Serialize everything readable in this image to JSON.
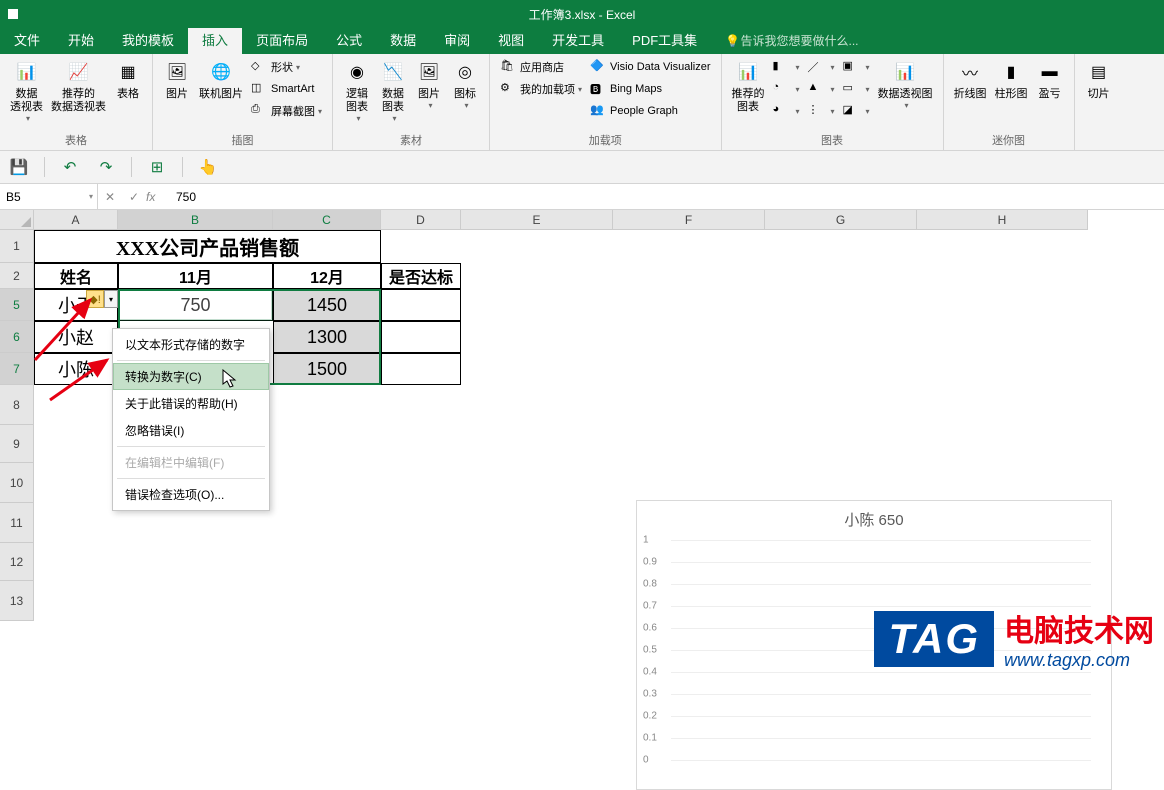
{
  "app": {
    "title": "工作簿3.xlsx - Excel"
  },
  "tabs": {
    "file": "文件",
    "home": "开始",
    "mytpl": "我的模板",
    "insert": "插入",
    "layout": "页面布局",
    "formula": "公式",
    "data": "数据",
    "review": "审阅",
    "view": "视图",
    "dev": "开发工具",
    "pdf": "PDF工具集",
    "tellme": "告诉我您想要做什么..."
  },
  "ribbon": {
    "tables": {
      "pivot": "数据\n透视表",
      "recpivot": "推荐的\n数据透视表",
      "table": "表格",
      "label": "表格"
    },
    "illus": {
      "pic": "图片",
      "online": "联机图片",
      "shapes": "形状",
      "smartart": "SmartArt",
      "screenshot": "屏幕截图",
      "label": "插图"
    },
    "addins": {
      "store": "应用商店",
      "myaddins": "我的加载项",
      "visio": "Visio Data Visualizer",
      "bing": "Bing Maps",
      "people": "People Graph",
      "label": "加载项"
    },
    "charts": {
      "rec": "推荐的\n图表",
      "pivotchart": "数据透视图",
      "label": "图表"
    },
    "material": {
      "logic": "逻辑\n图表",
      "data": "数据\n图表",
      "pic": "图片",
      "icon": "图标",
      "label": "素材"
    },
    "spark": {
      "line": "折线图",
      "col": "柱形图",
      "winloss": "盈亏",
      "label": "迷你图"
    },
    "slicer": "切片"
  },
  "fbar": {
    "name": "B5",
    "value": "750"
  },
  "cols": [
    "A",
    "B",
    "C",
    "D",
    "E",
    "F",
    "G",
    "H"
  ],
  "rows": [
    "1",
    "2",
    "5",
    "6",
    "7",
    "8",
    "9",
    "10",
    "11",
    "12",
    "13"
  ],
  "sheet": {
    "title": "XXX公司产品销售额",
    "headers": {
      "name": "姓名",
      "m11": "11月",
      "m12": "12月",
      "pass": "是否达标"
    },
    "rows": [
      {
        "name": "小于",
        "m11": "750",
        "m12": "1450"
      },
      {
        "name": "小赵",
        "m11": "",
        "m12": "1300"
      },
      {
        "name": "小陈",
        "m11": "",
        "m12": "1500"
      }
    ]
  },
  "ctx": {
    "stored_as_text": "以文本形式存储的数字",
    "convert": "转换为数字(C)",
    "help": "关于此错误的帮助(H)",
    "ignore": "忽略错误(I)",
    "edit": "在编辑栏中编辑(F)",
    "options": "错误检查选项(O)..."
  },
  "chart_data": {
    "type": "bar",
    "title": "小陈 650",
    "categories": [],
    "values": [],
    "ylim": [
      0,
      1
    ],
    "yticks": [
      0,
      0.1,
      0.2,
      0.3,
      0.4,
      0.5,
      0.6,
      0.7,
      0.8,
      0.9,
      1
    ]
  },
  "overlay": {
    "tag": "TAG",
    "line1": "电脑技术网",
    "line2": "www.tagxp.com"
  }
}
